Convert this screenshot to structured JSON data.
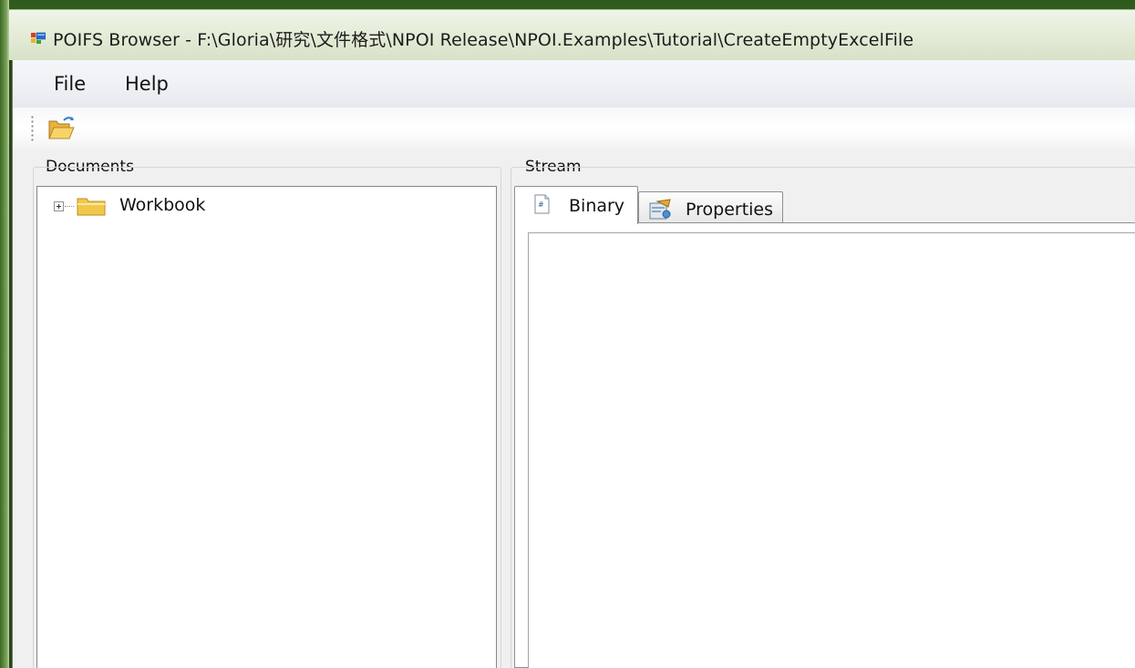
{
  "window": {
    "title": "POIFS Browser - F:\\Gloria\\研究\\文件格式\\NPOI Release\\NPOI.Examples\\Tutorial\\CreateEmptyExcelFile",
    "app_icon": "window-app-icon"
  },
  "menubar": {
    "items": [
      {
        "label": "File"
      },
      {
        "label": "Help"
      }
    ]
  },
  "toolbar": {
    "open_icon": "open-folder-icon"
  },
  "documents": {
    "label": "Documents",
    "tree": [
      {
        "label": "Workbook",
        "icon": "folder-icon",
        "expander": "plus-expander-icon"
      }
    ]
  },
  "stream": {
    "label": "Stream",
    "tabs": [
      {
        "label": "Binary",
        "icon": "binary-doc-icon",
        "active": true
      },
      {
        "label": "Properties",
        "icon": "properties-icon",
        "active": false
      }
    ]
  },
  "colors": {
    "frame_green": "#5f8a3e",
    "client_bg": "#f0f0f0",
    "border": "#828790"
  }
}
